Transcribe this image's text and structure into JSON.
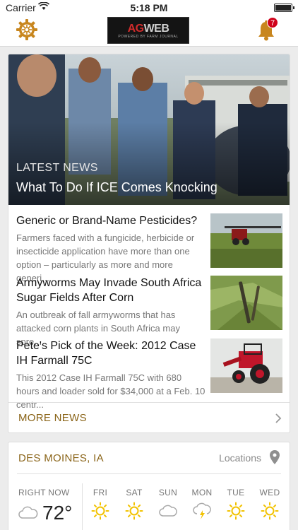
{
  "status_bar": {
    "carrier": "Carrier",
    "time": "5:18 PM"
  },
  "header": {
    "logo_main_1": "AG",
    "logo_main_2": "WEB",
    "logo_tagline": "POWERED BY FARM JOURNAL",
    "notification_count": "7",
    "icons": [
      "gear-icon",
      "bell-icon"
    ]
  },
  "hero": {
    "kicker": "LATEST NEWS",
    "title": "What To Do If ICE Comes Knocking"
  },
  "articles": [
    {
      "title": "Generic or Brand-Name Pesticides?",
      "snippet": "Farmers faced with a fungicide, herbicide or insecticide application have more than one option – particularly as more and more generi..."
    },
    {
      "title": "Armyworms May Invade South Africa Sugar Fields After Corn",
      "snippet": "An outbreak of fall armyworms that has attacked corn plants in South Africa may spre..."
    },
    {
      "title": "Pete's Pick of the Week: 2012 Case IH Farmall 75C",
      "snippet": "This 2012 Case IH Farmall 75C with 680 hours and loader sold for $34,000 at a Feb. 10 centr..."
    }
  ],
  "more_news_label": "MORE NEWS",
  "weather": {
    "city": "DES MOINES, IA",
    "locations_label": "Locations",
    "now_label": "RIGHT NOW",
    "now_temp": "72°",
    "now_icon": "cloud-icon",
    "days": [
      {
        "name": "FRI",
        "icon": "sun-icon"
      },
      {
        "name": "SAT",
        "icon": "sun-icon"
      },
      {
        "name": "SUN",
        "icon": "cloud-icon"
      },
      {
        "name": "MON",
        "icon": "thunder-icon"
      },
      {
        "name": "TUE",
        "icon": "sun-icon"
      },
      {
        "name": "WED",
        "icon": "sun-icon"
      }
    ]
  },
  "colors": {
    "accent": "#8a6418",
    "icon_gold": "#c8861e",
    "sun_yellow": "#f2c200",
    "badge_red": "#d0021b"
  }
}
